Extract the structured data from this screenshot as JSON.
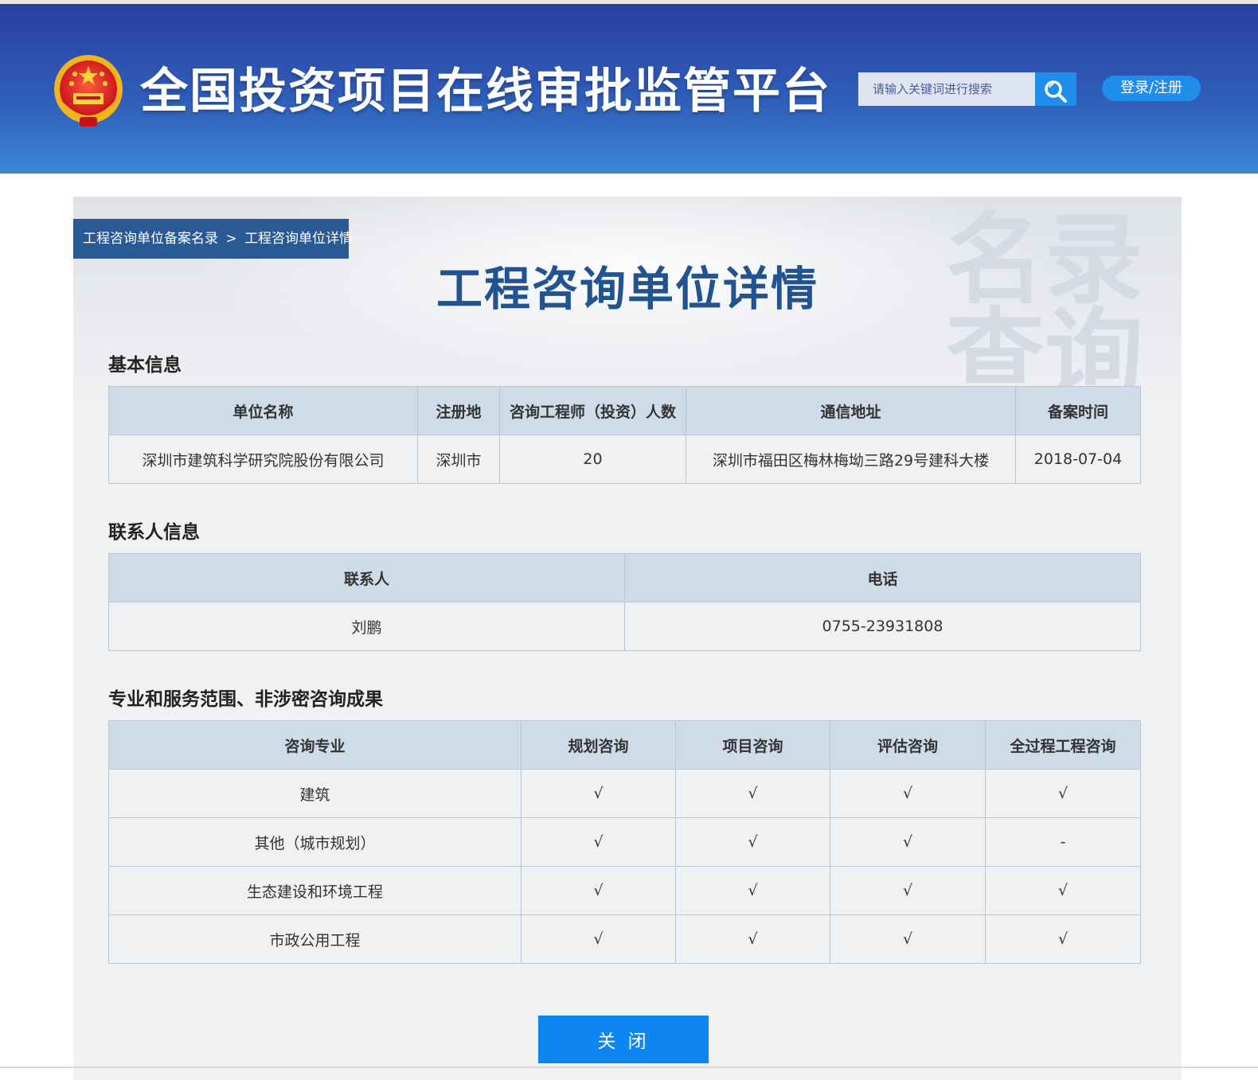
{
  "header": {
    "site_title": "全国投资项目在线审批监管平台",
    "search_placeholder": "请输入关键词进行搜索",
    "login_label": "登录/注册"
  },
  "breadcrumb": {
    "parent": "工程咨询单位备案名录",
    "separator": ">",
    "current": "工程咨询单位详情"
  },
  "page_title": "工程咨询单位详情",
  "watermark": {
    "line1": "名录",
    "line2": "查询"
  },
  "basic_info": {
    "title": "基本信息",
    "headers": [
      "单位名称",
      "注册地",
      "咨询工程师（投资）人数",
      "通信地址",
      "备案时间"
    ],
    "row": [
      "深圳市建筑科学研究院股份有限公司",
      "深圳市",
      "20",
      "深圳市福田区梅林梅坳三路29号建科大楼",
      "2018-07-04"
    ]
  },
  "contact_info": {
    "title": "联系人信息",
    "headers": [
      "联系人",
      "电话"
    ],
    "row": [
      "刘鹏",
      "0755-23931808"
    ]
  },
  "services": {
    "title": "专业和服务范围、非涉密咨询成果",
    "headers": [
      "咨询专业",
      "规划咨询",
      "项目咨询",
      "评估咨询",
      "全过程工程咨询"
    ],
    "rows": [
      [
        "建筑",
        "√",
        "√",
        "√",
        "√"
      ],
      [
        "其他（城市规划）",
        "√",
        "√",
        "√",
        "-"
      ],
      [
        "生态建设和环境工程",
        "√",
        "√",
        "√",
        "√"
      ],
      [
        "市政公用工程",
        "√",
        "√",
        "√",
        "√"
      ]
    ]
  },
  "close_label": "关 闭",
  "colors": {
    "header_top": "#2a3f9f",
    "header_bottom": "#3a86d2",
    "accent": "#0d86f2",
    "title_blue": "#22528f"
  }
}
